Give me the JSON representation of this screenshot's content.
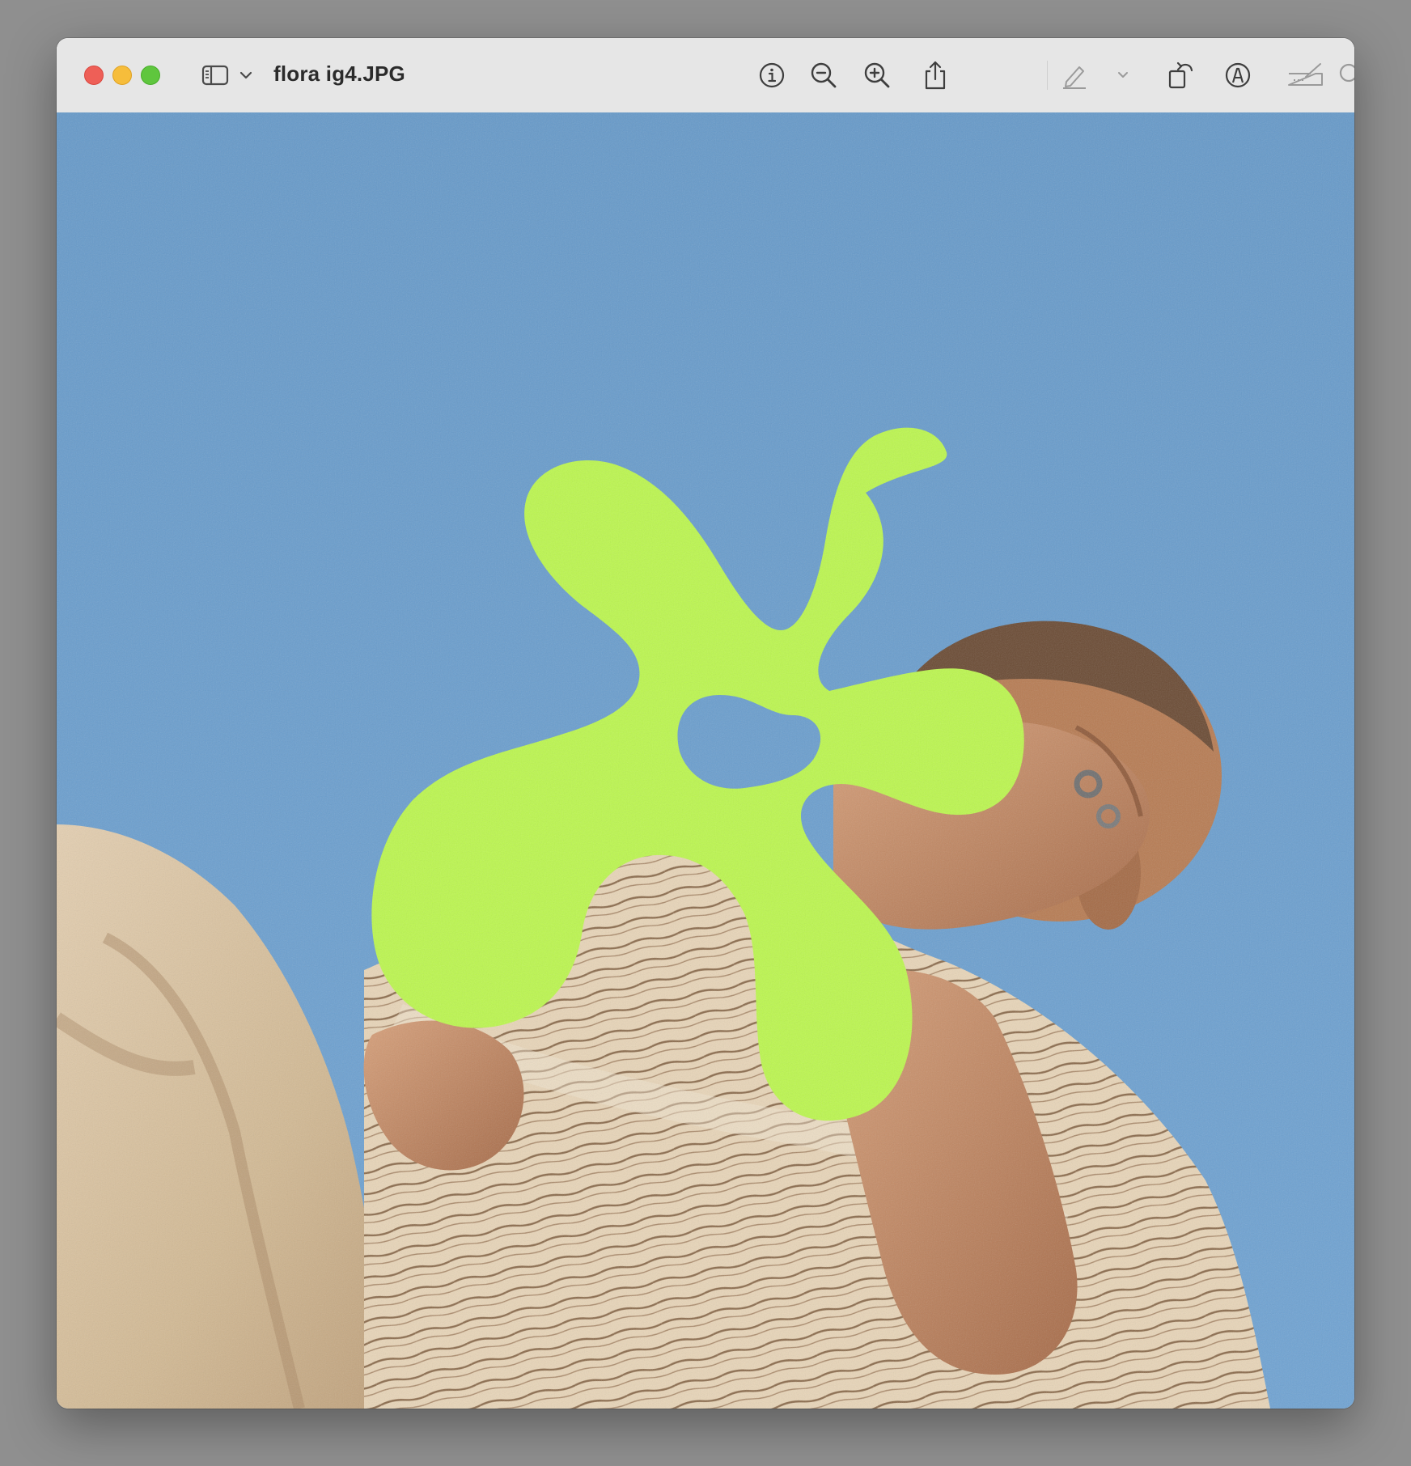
{
  "window": {
    "title": "flora ig4.JPG"
  },
  "toolbar": {
    "sidebar_toggle_icon": "sidebar-icon",
    "sidebar_menu_icon": "chevron-down-icon",
    "info_icon": "info-icon",
    "zoom_out_icon": "zoom-out-icon",
    "zoom_in_icon": "zoom-in-icon",
    "share_icon": "share-icon",
    "highlight_icon": "pencil-icon",
    "highlight_menu_icon": "chevron-down-icon",
    "rotate_icon": "rotate-icon",
    "markup_icon": "markup-icon",
    "signature_icon": "signature-icon",
    "search_icon": "search-icon"
  },
  "image": {
    "description_colors": {
      "sky": "#6a9ccc",
      "blob": "#bcf74e",
      "shirt": "#d9c3a5",
      "skin": "#c48a62"
    }
  }
}
